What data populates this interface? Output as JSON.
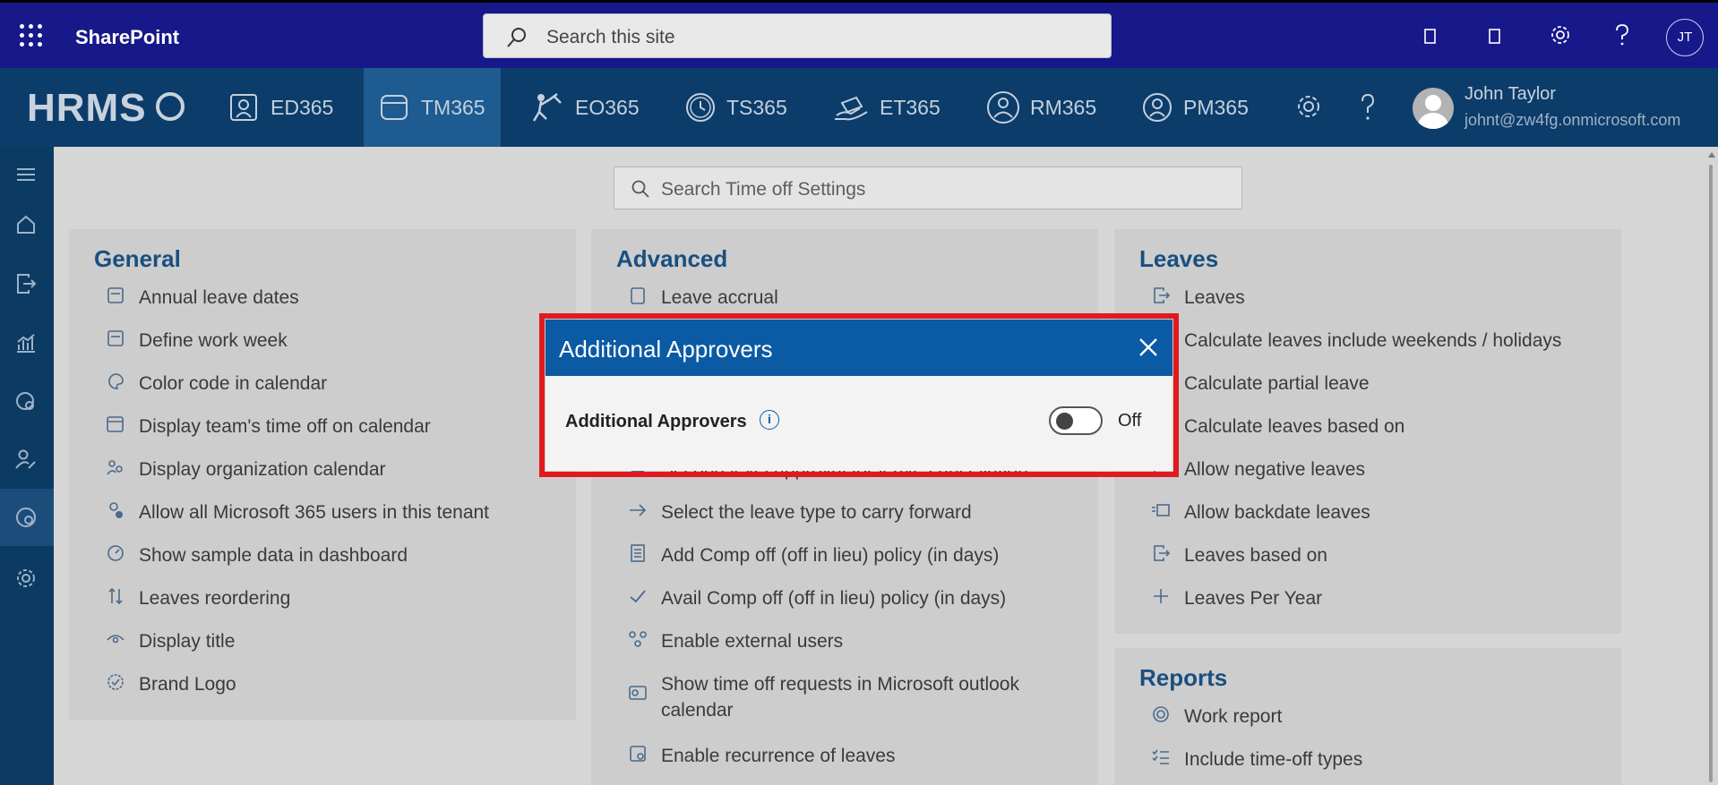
{
  "suitebar": {
    "title": "SharePoint",
    "search_placeholder": "Search this site",
    "user_initials": "JT"
  },
  "appbar": {
    "logo": "HRMS",
    "modules": [
      {
        "label": "ED365",
        "active": false
      },
      {
        "label": "TM365",
        "active": true
      },
      {
        "label": "EO365",
        "active": false
      },
      {
        "label": "TS365",
        "active": false
      },
      {
        "label": "ET365",
        "active": false
      },
      {
        "label": "RM365",
        "active": false
      },
      {
        "label": "PM365",
        "active": false
      }
    ],
    "user": {
      "name": "John Taylor",
      "email": "johnt@zw4fg.onmicrosoft.com"
    }
  },
  "settings_search": {
    "placeholder": "Search Time off Settings"
  },
  "panels": {
    "general": {
      "title": "General",
      "items": [
        "Annual leave dates",
        "Define work week",
        "Color code in calendar",
        "Display team's time off on calendar",
        "Display organization calendar",
        "Allow all Microsoft 365 users in this tenant",
        "Show sample data in dashboard",
        "Leaves reordering",
        "Display title",
        "Brand Logo"
      ]
    },
    "advanced": {
      "title": "Advanced",
      "items": [
        "Leave accrual",
        "Second level approval for leave cancellation.",
        "Select the leave type to carry forward",
        "Add Comp off (off in lieu) policy (in days)",
        "Avail Comp off (off in lieu) policy (in days)",
        "Enable external users",
        "Show time off requests in Microsoft outlook calendar",
        "Enable recurrence of leaves"
      ]
    },
    "leaves": {
      "title": "Leaves",
      "items": [
        "Leaves",
        "Calculate leaves include weekends / holidays",
        "Calculate partial leave",
        "Calculate leaves based on",
        "Allow negative leaves",
        "Allow backdate leaves",
        "Leaves based on",
        "Leaves Per Year"
      ]
    },
    "reports": {
      "title": "Reports",
      "items": [
        "Work report",
        "Include time-off types"
      ]
    }
  },
  "modal": {
    "title": "Additional Approvers",
    "field_label": "Additional Approvers",
    "toggle_state": "Off",
    "toggle_on": false
  },
  "colors": {
    "suitebar": "#17188a",
    "appbar": "#0c3c6a",
    "modal_header": "#0b5aa4",
    "highlight": "#e01a1f"
  }
}
